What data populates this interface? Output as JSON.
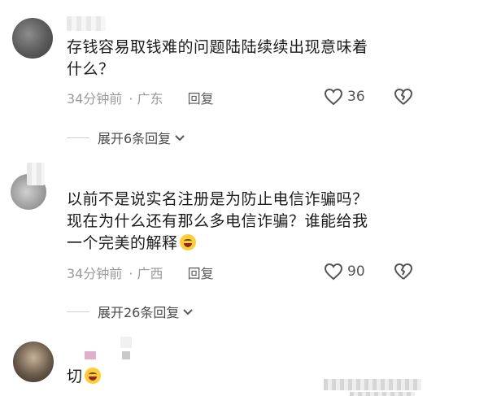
{
  "comments": [
    {
      "text_lines": [
        "存钱容易取钱难的问题陆陆续续出现意味着",
        "什么？"
      ],
      "time": "34分钟前",
      "location": "· 广东",
      "reply_label": "回复",
      "likes": "36",
      "expand_label": "展开6条回复"
    },
    {
      "text_lines": [
        "以前不是说实名注册是为防止电信诈骗吗？",
        "现在为什么还有那么多电信诈骗？谁能给我",
        "一个完美的解释"
      ],
      "time": "34分钟前",
      "location": "· 广西",
      "reply_label": "回复",
      "likes": "90",
      "expand_label": "展开26条回复"
    },
    {
      "text_lines": [
        "切"
      ]
    }
  ],
  "icons": {
    "like": "heart-outline-icon",
    "dislike": "broken-heart-icon",
    "expand": "chevron-down-icon",
    "emoji": "rofl-emoji-icon"
  },
  "colors": {
    "text": "#1b1b1b",
    "meta": "#9a9a9a",
    "icon": "#555555"
  }
}
